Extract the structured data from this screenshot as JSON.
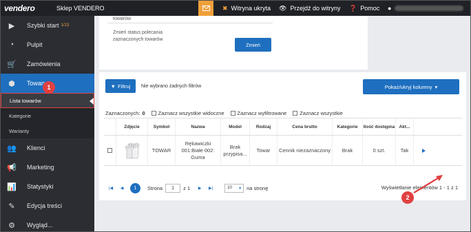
{
  "topbar": {
    "logo": "vendero",
    "shop_name": "Sklep VENDERO",
    "mail_icon": "envelope-icon",
    "items": [
      {
        "icon": "warning-icon",
        "label": "Witryna ukryta"
      },
      {
        "icon": "eye-icon",
        "label": "Przejdź do witryny"
      },
      {
        "icon": "question-icon",
        "label": "Pomoc"
      },
      {
        "icon": "user-icon",
        "label": ""
      }
    ]
  },
  "sidebar": {
    "items": [
      {
        "icon": "play-icon",
        "label": "Szybki start",
        "badge": "1/13"
      },
      {
        "icon": "dashboard-icon",
        "label": "Pulpit"
      },
      {
        "icon": "cart-icon",
        "label": "Zamówienia"
      },
      {
        "icon": "box-icon",
        "label": "Towary",
        "active": true
      },
      {
        "icon": "users-icon",
        "label": "Klienci"
      },
      {
        "icon": "megaphone-icon",
        "label": "Marketing"
      },
      {
        "icon": "chart-icon",
        "label": "Statystyki"
      },
      {
        "icon": "edit-icon",
        "label": "Edycja treści"
      },
      {
        "icon": "cog-icon",
        "label": "Wygląd..."
      }
    ],
    "subitems": [
      {
        "label": "Lista towarów",
        "active": true
      },
      {
        "label": "Kategorie"
      },
      {
        "label": "Warianty"
      }
    ]
  },
  "annotations": {
    "badge1": "1",
    "badge2": "2"
  },
  "status_panel": {
    "prev_label": "towarów",
    "label": "Zmień status polecania zaznaczonych towarów",
    "button": "Zmień"
  },
  "filters": {
    "button": "Filtruj",
    "no_filters": "Nie wybrano żadnych filtrów",
    "columns_button": "Pokaż/ukryj kolumny"
  },
  "selection": {
    "selected_label": "Zaznaczonych:",
    "selected_count": "0",
    "check_visible": "Zaznacz wszystkie widoczne",
    "check_filtered": "Zaznacz wyfiltrowane",
    "check_all": "Zaznacz wszystkie"
  },
  "table": {
    "headers": [
      "",
      "Zdjęcie",
      "Symbol",
      "Nazwa",
      "Model",
      "Rodzaj",
      "Cena brutto",
      "Kategorie",
      "Ilość dostępna",
      "Akt...",
      ""
    ],
    "rows": [
      {
        "symbol": "TOWAR",
        "name": "Rękawiczki 001:Białe 002: Guma",
        "model": "Brak przypisa...",
        "type": "Towar",
        "price": "Cennik niezaznaczony",
        "category": "Brak",
        "qty": "0 szt.",
        "active": "Tak"
      }
    ]
  },
  "pager": {
    "current": "1",
    "page_label": "Strona",
    "page_value": "1",
    "of_label": "z 1",
    "per_page": "10",
    "per_page_label": "na stronę",
    "info": "Wyświetlanie elementów 1 - 1 z 1"
  },
  "colors": {
    "accent": "#1e6fbf",
    "sidebar": "#2b2d33",
    "annotation": "#e04040",
    "warning": "#f0a03a"
  }
}
